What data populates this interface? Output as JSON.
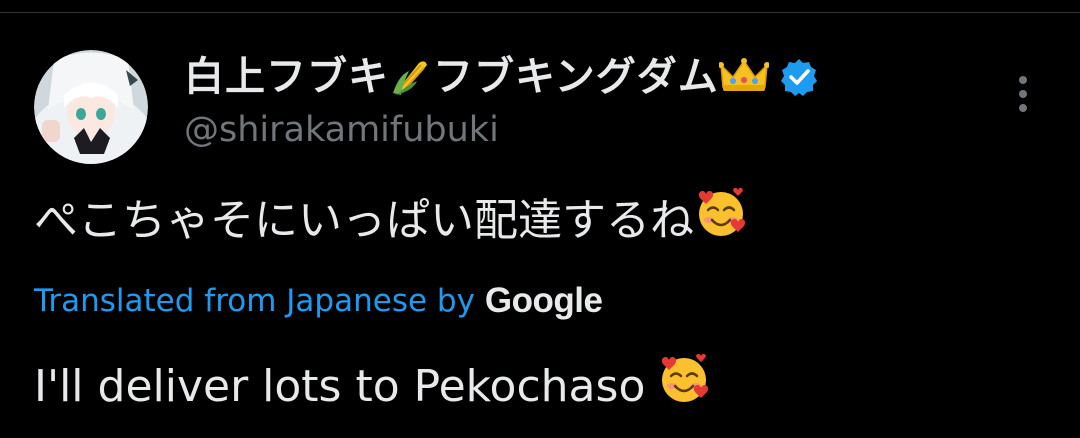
{
  "tweet": {
    "display_name_part1": "白上フブキ",
    "display_name_part2": "フブキングダム",
    "corn_emoji_icon": "corn-emoji",
    "crown_emoji_icon": "crown-emoji",
    "verified_icon": "verified-badge-icon",
    "handle": "@shirakamifubuki",
    "text": "ぺこちゃそにいっぱい配達するね",
    "translation_label": "Translated from Japanese by",
    "translation_provider": "Google",
    "translated_text": "I'll deliver lots to Pekochaso",
    "emoji": "smiling-face-with-hearts"
  },
  "colors": {
    "background": "#000000",
    "text_primary": "#e7e9ea",
    "text_secondary": "#71767b",
    "link": "#1d9bf0",
    "verified": "#1d9bf0"
  }
}
